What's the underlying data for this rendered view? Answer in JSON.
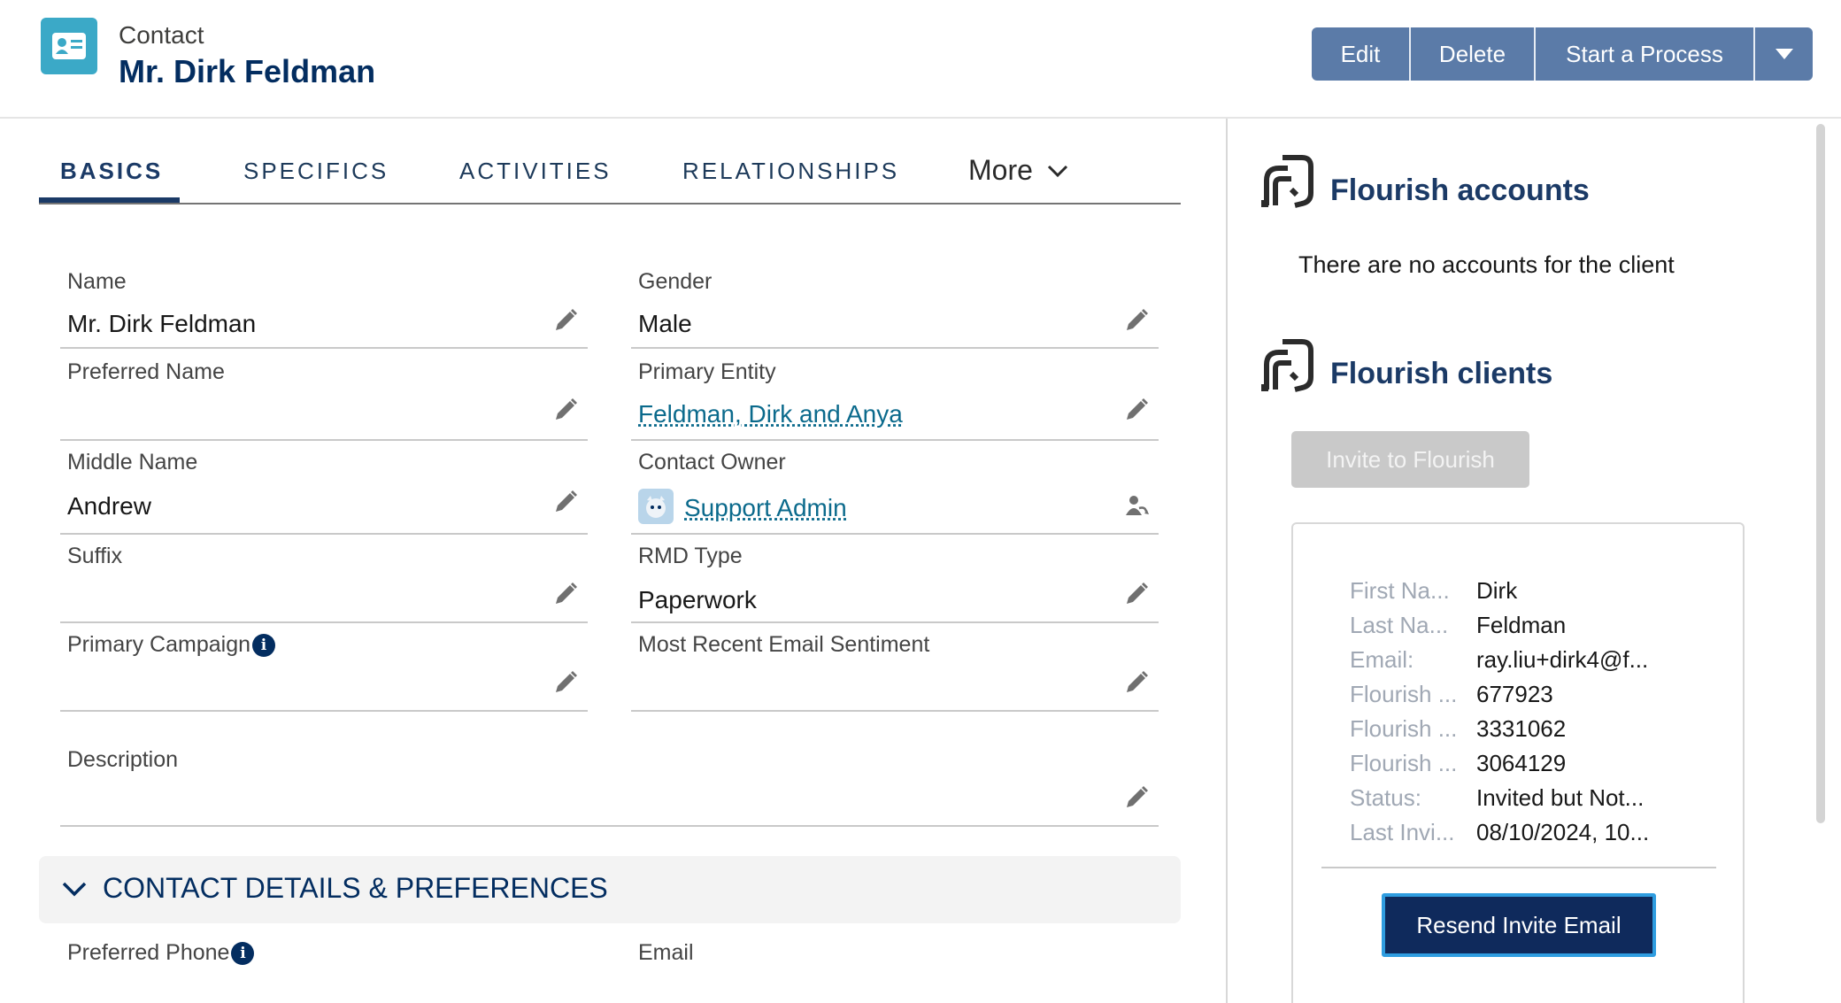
{
  "header": {
    "object_type": "Contact",
    "record_name": "Mr. Dirk Feldman",
    "buttons": {
      "edit": "Edit",
      "delete": "Delete",
      "start_process": "Start a Process"
    }
  },
  "tabs": [
    {
      "label": "BASICS",
      "active": true
    },
    {
      "label": "SPECIFICS"
    },
    {
      "label": "ACTIVITIES"
    },
    {
      "label": "RELATIONSHIPS"
    }
  ],
  "tab_more": "More",
  "fields": {
    "name": {
      "label": "Name",
      "value": "Mr. Dirk Feldman"
    },
    "gender": {
      "label": "Gender",
      "value": "Male"
    },
    "preferred_name": {
      "label": "Preferred Name",
      "value": ""
    },
    "primary_entity": {
      "label": "Primary Entity",
      "value": "Feldman, Dirk and Anya"
    },
    "middle_name": {
      "label": "Middle Name",
      "value": "Andrew"
    },
    "contact_owner": {
      "label": "Contact Owner",
      "value": "Support Admin"
    },
    "suffix": {
      "label": "Suffix",
      "value": ""
    },
    "rmd_type": {
      "label": "RMD Type",
      "value": "Paperwork"
    },
    "primary_campaign": {
      "label": "Primary Campaign",
      "value": ""
    },
    "email_sentiment": {
      "label": "Most Recent Email Sentiment",
      "value": ""
    },
    "description": {
      "label": "Description",
      "value": ""
    },
    "preferred_phone": {
      "label": "Preferred Phone"
    },
    "email": {
      "label": "Email"
    }
  },
  "section": {
    "title": "CONTACT DETAILS & PREFERENCES"
  },
  "flourish": {
    "accounts_title": "Flourish accounts",
    "no_accounts": "There are no accounts for the client",
    "clients_title": "Flourish clients",
    "invite_label": "Invite to Flourish",
    "client_rows": [
      {
        "key": "First Na...",
        "value": "Dirk"
      },
      {
        "key": "Last Na...",
        "value": "Feldman"
      },
      {
        "key": "Email:",
        "value": "ray.liu+dirk4@f..."
      },
      {
        "key": "Flourish ...",
        "value": "677923"
      },
      {
        "key": "Flourish ...",
        "value": "3331062"
      },
      {
        "key": "Flourish ...",
        "value": "3064129"
      },
      {
        "key": "Status:",
        "value": "Invited but Not..."
      },
      {
        "key": "Last Invi...",
        "value": "08/10/2024, 10..."
      }
    ],
    "resend_label": "Resend Invite Email"
  },
  "colors": {
    "brand_navy": "#032d60",
    "button_blue": "#5b7ba8",
    "icon_teal": "#3ba9c7",
    "link": "#0b6a8c"
  }
}
